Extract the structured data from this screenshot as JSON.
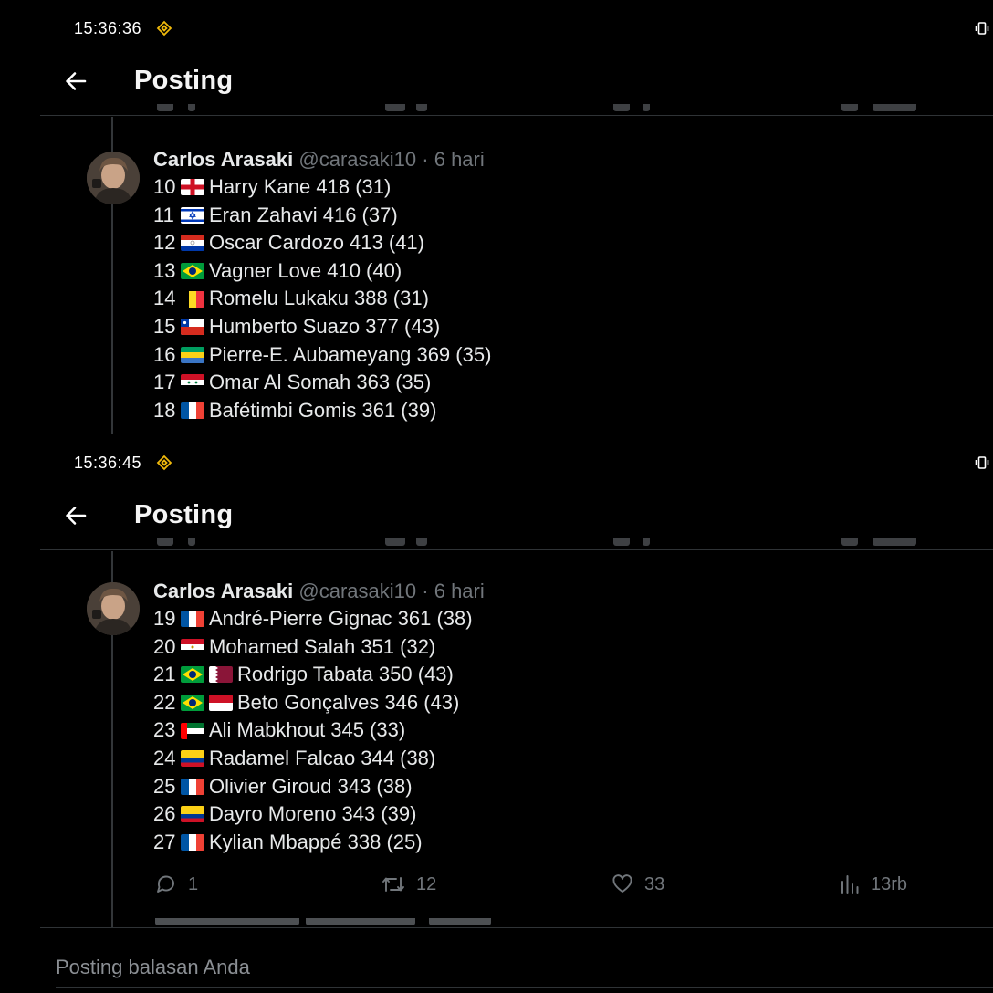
{
  "screens": [
    {
      "status_time": "15:36:36",
      "header_title": "Posting",
      "author_name": "Carlos Arasaki",
      "author_handle": "@carasaki10",
      "separator": "·",
      "age": "6 hari",
      "lines": [
        {
          "rank": "10",
          "flags": [
            "England"
          ],
          "text": "Harry Kane 418 (31)"
        },
        {
          "rank": "11",
          "flags": [
            "Israel"
          ],
          "text": "Eran Zahavi 416 (37)"
        },
        {
          "rank": "12",
          "flags": [
            "Paraguay"
          ],
          "text": "Oscar Cardozo 413 (41)"
        },
        {
          "rank": "13",
          "flags": [
            "Brazil"
          ],
          "text": "Vagner Love 410 (40)"
        },
        {
          "rank": "14",
          "flags": [
            "Belgium"
          ],
          "text": "Romelu Lukaku 388 (31)"
        },
        {
          "rank": "15",
          "flags": [
            "Chile"
          ],
          "text": "Humberto Suazo 377 (43)"
        },
        {
          "rank": "16",
          "flags": [
            "Gabon"
          ],
          "text": "Pierre-E. Aubameyang 369 (35)"
        },
        {
          "rank": "17",
          "flags": [
            "Syria"
          ],
          "text": "Omar Al Somah 363 (35)"
        },
        {
          "rank": "18",
          "flags": [
            "France"
          ],
          "text": "Bafétimbi Gomis 361 (39)"
        }
      ]
    },
    {
      "status_time": "15:36:45",
      "header_title": "Posting",
      "author_name": "Carlos Arasaki",
      "author_handle": "@carasaki10",
      "separator": "·",
      "age": "6 hari",
      "lines": [
        {
          "rank": "19",
          "flags": [
            "France"
          ],
          "text": "André-Pierre Gignac 361 (38)"
        },
        {
          "rank": "20",
          "flags": [
            "Egypt"
          ],
          "text": "Mohamed Salah 351 (32)"
        },
        {
          "rank": "21",
          "flags": [
            "Brazil",
            "Qatar"
          ],
          "text": "Rodrigo Tabata 350 (43)"
        },
        {
          "rank": "22",
          "flags": [
            "Brazil",
            "Indonesia"
          ],
          "text": "Beto Gonçalves 346 (43)"
        },
        {
          "rank": "23",
          "flags": [
            "UAE"
          ],
          "text": "Ali Mabkhout 345 (33)"
        },
        {
          "rank": "24",
          "flags": [
            "Colombia"
          ],
          "text": "Radamel Falcao 344 (38)"
        },
        {
          "rank": "25",
          "flags": [
            "France"
          ],
          "text": "Olivier Giroud 343 (38)"
        },
        {
          "rank": "26",
          "flags": [
            "Colombia"
          ],
          "text": "Dayro Moreno 343 (39)"
        },
        {
          "rank": "27",
          "flags": [
            "France"
          ],
          "text": "Kylian Mbappé 338 (25)"
        }
      ],
      "actions": {
        "replies": "1",
        "reposts": "12",
        "likes": "33",
        "views": "13rb"
      },
      "reply_placeholder": "Posting balasan Anda"
    }
  ],
  "icons": {
    "status_app": "binance-diamond-icon",
    "status_right": "vibrate-icon",
    "back": "arrow-left-icon",
    "reply": "speech-bubble-icon",
    "repost": "repost-icon",
    "like": "heart-icon",
    "views": "bar-chart-icon"
  },
  "colors": {
    "background": "#000000",
    "text": "#e7e9ea",
    "muted": "#71767b",
    "divider": "#2f3336",
    "status_icon": "#f0b90b"
  }
}
